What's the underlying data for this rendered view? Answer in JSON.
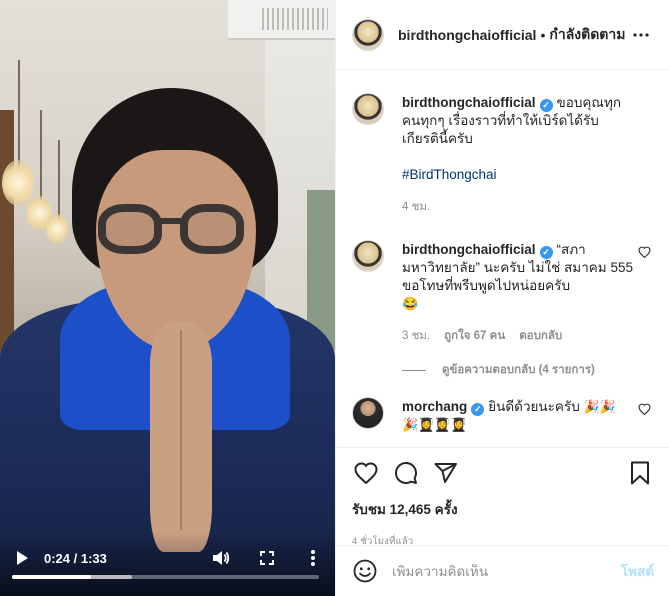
{
  "video": {
    "current_time": "0:24",
    "separator": " / ",
    "duration": "1:33",
    "progress_fraction": 0.258,
    "buffered_fraction": 0.39
  },
  "header": {
    "username": "birdthongchaiofficial",
    "dot": "•",
    "follow_status": "กำลังติดตาม"
  },
  "caption": {
    "username": "birdthongchaiofficial",
    "text": "ขอบคุณทุกคนทุกๆ เรื่องราวที่ทำให้เบิร์ดได้รับเกียรตินี้ครับ",
    "hashtag": "#BirdThongchai",
    "time": "4 ชม."
  },
  "comments": [
    {
      "username": "birdthongchaiofficial",
      "text": "“สภามหาวิทยาลัย” นะครับ ไม่ใช่ สมาคม 555 ขอโทษที่พรีบพูดไปหน่อยครับ",
      "emoji": "😂",
      "time": "3 ชม.",
      "likes": "ถูกใจ 67 คน",
      "reply": "ตอบกลับ",
      "view_replies": "ดูข้อความตอบกลับ (4 รายการ)"
    },
    {
      "username": "morchang",
      "text": "ยินดีด้วยนะครับ",
      "emojis_line1": "🎉🎉",
      "emojis_line2": "🎉👩‍🎓👩‍🎓👩‍🎓"
    }
  ],
  "stats": {
    "views": "รับชม 12,465 ครั้ง",
    "time_ago": "4 ชั่วโมงที่แล้ว"
  },
  "add_comment": {
    "placeholder": "เพิ่มความคิดเห็น",
    "post_label": "โพสต์"
  },
  "colors": {
    "link": "#00376b",
    "verified": "#3897f0",
    "post_disabled": "#b2dffc",
    "muted": "#8e8e8e"
  }
}
